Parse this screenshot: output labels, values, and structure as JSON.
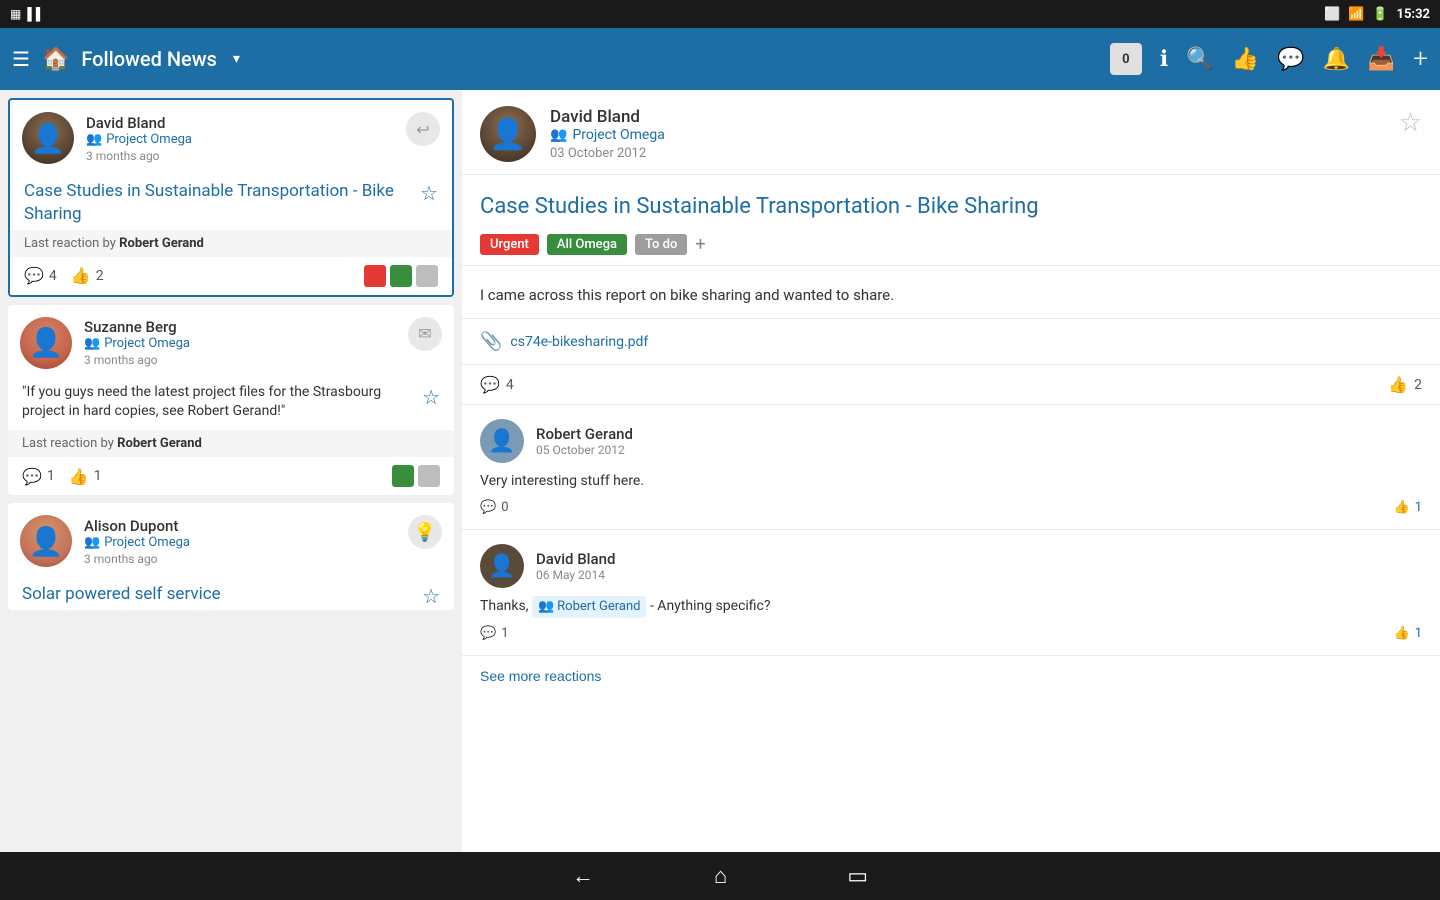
{
  "statusBar": {
    "time": "15:32",
    "leftIcons": [
      "sim-icon",
      "barcode-icon"
    ]
  },
  "navBar": {
    "title": "Followed News",
    "badgeCount": "0",
    "icons": [
      "info-icon",
      "search-icon",
      "like-icon",
      "comment-icon",
      "bell-icon",
      "inbox-icon",
      "add-icon"
    ]
  },
  "feedItems": [
    {
      "id": "feed-1",
      "selected": true,
      "author": "David Bland",
      "project": "Project Omega",
      "time": "3 months ago",
      "title": "Case Studies in Sustainable Transportation - Bike Sharing",
      "lastReaction": "Robert Gerand",
      "commentCount": "4",
      "likeCount": "2",
      "colors": [
        "#e53935",
        "#388e3c",
        "#bdbdbd"
      ],
      "actionIcon": "reply-icon"
    },
    {
      "id": "feed-2",
      "selected": false,
      "author": "Suzanne Berg",
      "project": "Project Omega",
      "time": "3 months ago",
      "content": "\"If you guys need the latest project files for the Strasbourg project in hard copies, see Robert Gerand!\"",
      "lastReaction": "Robert Gerand",
      "commentCount": "1",
      "likeCount": "1",
      "colors": [
        "#388e3c",
        "#bdbdbd"
      ],
      "actionIcon": "mail-icon"
    },
    {
      "id": "feed-3",
      "selected": false,
      "author": "Alison Dupont",
      "project": "Project Omega",
      "time": "3 months ago",
      "title": "Solar powered self service",
      "actionIcon": "lightbulb-icon"
    }
  ],
  "post": {
    "author": "David Bland",
    "project": "Project Omega",
    "date": "03 October 2012",
    "title": "Case Studies in Sustainable Transportation - Bike Sharing",
    "tags": [
      "Urgent",
      "All Omega",
      "To do"
    ],
    "body": "I came across this report on bike sharing and wanted to share.",
    "attachment": "cs74e-bikesharing.pdf",
    "commentCount": "4",
    "likeCount": "2"
  },
  "comments": [
    {
      "id": "comment-1",
      "author": "Robert Gerand",
      "date": "05 October 2012",
      "body": "Very interesting stuff here.",
      "replyCount": "0",
      "likeCount": "1"
    },
    {
      "id": "comment-2",
      "author": "David Bland",
      "date": "06 May 2014",
      "body": "Thanks,",
      "mention": "Robert Gerand",
      "bodyAfter": "- Anything specific?",
      "replyCount": "1",
      "likeCount": "1"
    }
  ],
  "seeMore": "See more reactions",
  "bottomNav": {
    "icons": [
      "back-icon",
      "home-icon",
      "recents-icon"
    ]
  },
  "labels": {
    "lastReactionPrefix": "Last reaction by",
    "commentIcon": "💬",
    "likeIcon": "👍",
    "starIcon": "☆",
    "attachIcon": "📎",
    "groupIcon": "👥"
  }
}
